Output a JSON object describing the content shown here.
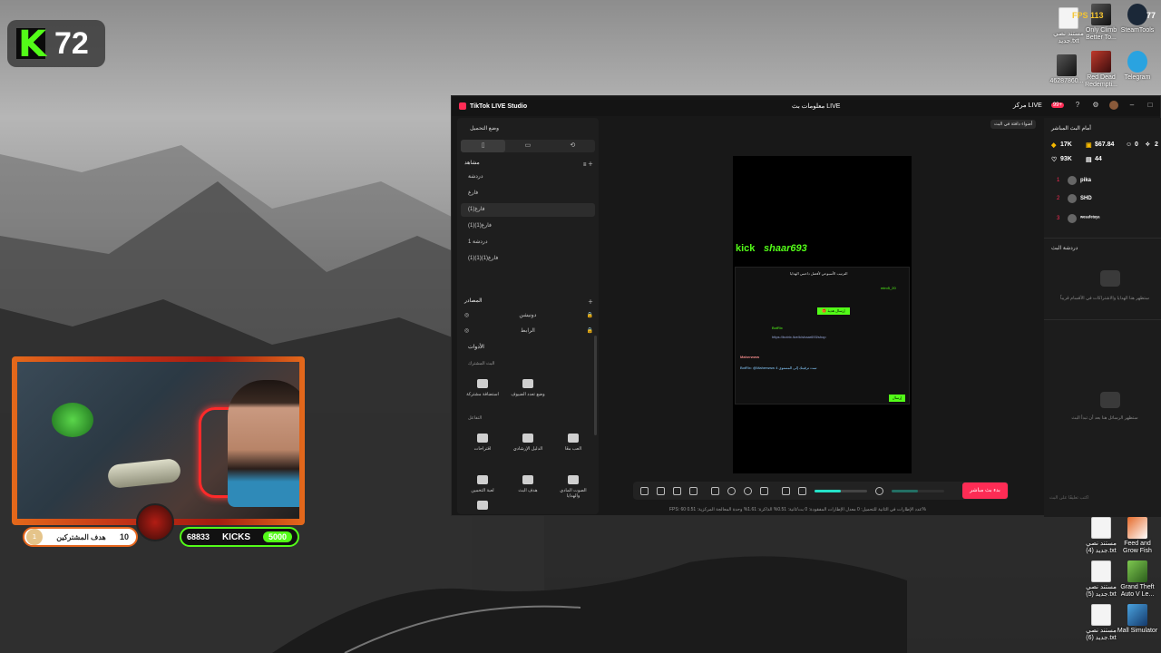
{
  "kick_counter": {
    "count": "72"
  },
  "desktop_icons": {
    "top": [
      {
        "label": "مستند نصي جديد.txt",
        "icon": "text-file-icon"
      },
      {
        "label": "Only Climb Better To...",
        "icon": "game-icon"
      },
      {
        "label": "SteamTools",
        "icon": "steamtools-icon"
      },
      {
        "label": "46287860...",
        "icon": "image-icon"
      },
      {
        "label": "Red Dead Redempti...",
        "icon": "game-icon"
      },
      {
        "label": "Telegram",
        "icon": "telegram-icon"
      }
    ],
    "overlay_fps": "FPS 113",
    "overlay_temp": "77",
    "bottom": [
      {
        "label": "مستند نصي جديد (4).txt",
        "icon": "text-file-icon"
      },
      {
        "label": "Feed and Grow Fish",
        "icon": "game-icon"
      },
      {
        "label": "مستند نصي جديد (5).txt",
        "icon": "text-file-icon"
      },
      {
        "label": "Grand Theft Auto V Le...",
        "icon": "game-icon"
      },
      {
        "label": "مستند نصي جديد (6).txt",
        "icon": "text-file-icon"
      },
      {
        "label": "Mall Simulator",
        "icon": "game-icon"
      }
    ]
  },
  "studio": {
    "app_title": "TikTok LIVE Studio",
    "center_title": "معلومات بث LIVE",
    "home_label": "مركز LIVE",
    "notif_badge": "99+",
    "left": {
      "record_mode": "وضع التحميل",
      "scenes_title": "مشاهد",
      "scenes": [
        "دردشة",
        "فارغ",
        "فارغ(1)",
        "فارغ(1)(1)",
        "دردشة 1",
        "فارغ(1)(1)(1)"
      ],
      "sources_title": "المصادر",
      "sources": [
        "دونيشن",
        "الرابط"
      ],
      "tools_title": "الأدوات",
      "tools_sub1": "البث المشترك",
      "tools_sub2": "التفاعل",
      "tools": [
        {
          "label": "استضافة مشتركة",
          "icon": "co-host-icon"
        },
        {
          "label": "وضع تعدد الضيوف",
          "icon": "multi-guest-icon"
        },
        {
          "label": "اقتراحات",
          "icon": "suggestions-icon"
        },
        {
          "label": "الدليل الإرشادي",
          "icon": "guide-icon"
        },
        {
          "label": "العب معًا",
          "icon": "play-together-icon"
        },
        {
          "label": "لعبة التخمين",
          "icon": "guess-game-icon"
        },
        {
          "label": "هدف البث",
          "icon": "live-goal-icon"
        },
        {
          "label": "الصوت المادي والهدايا",
          "icon": "gift-sound-icon"
        },
        {
          "label": "",
          "icon": "settings-icon"
        }
      ]
    },
    "tip": "أضواء دافئة في البث",
    "canvas": {
      "kick_logo": "kick",
      "kick_user": "shaar693",
      "chat_header": "الترتيب الأسبوعي لأفضل داعمي الهدايا",
      "chat_user": "miro5_20",
      "chat_green": "🎁 إرسال هدية",
      "bot_name": "BotRix",
      "chat_link": "https://botrix.live/k/shaar693/shop",
      "chat_name": "Maherwww",
      "chat_bot_msg": "BotRix: @Maherwww تمت ترقيتك إلى المستوى 4",
      "chat_send": "إرسال"
    },
    "golive": "بدء بث مباشر",
    "status": "FPS: 60  عدد الإطارات في الثانية للتحميل: 0  معدل الإطارات المفقودة: 0  بت/ثانية: 0.51%  الذاكرة: 1.61%  وحدة المعالجة المركزية: 0.51%",
    "right": {
      "title": "أمام البث المباشر",
      "stats": {
        "coins": "17K",
        "revenue": "$67.84",
        "viewers": "0",
        "shares": "2",
        "likes": "93K",
        "gifts": "44"
      },
      "ranking": [
        {
          "rank": "1",
          "name": "pika"
        },
        {
          "rank": "2",
          "name": "SHD"
        },
        {
          "rank": "3",
          "name": "ʷᵉˢᵃᶠᵉᵗᵘʸᵃ"
        }
      ],
      "chat_title": "دردشة البث",
      "gifts_empty": "ستظهر هنا الهدايا والاشتراكات في الأقسام قريباً",
      "chat_empty": "ستظهر الرسائل هنا بعد أن تبدأ البث",
      "input_placeholder": "اكتب تعليقًا على البث"
    }
  },
  "overlay": {
    "sub_goal_label": "هدف المشتركين",
    "sub_goal_current": "10",
    "sub_goal_badge": "1",
    "kick_goal_current": "68833",
    "kick_goal_label": "KICKS",
    "kick_goal_target": "5000"
  },
  "colors": {
    "kick_green": "#53fc18",
    "tiktok_red": "#fe2c55",
    "frame_orange": "#e4691b"
  }
}
